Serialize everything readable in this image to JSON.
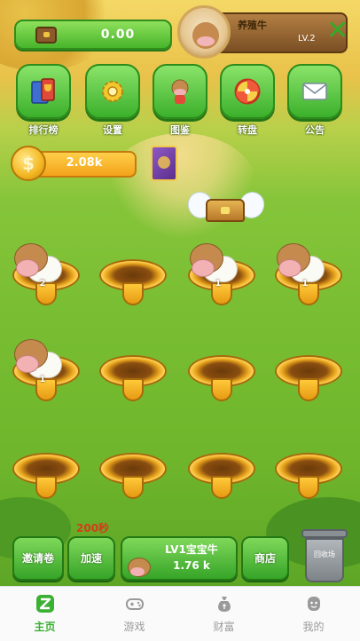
{
  "wallet": {
    "icon": "wallet-icon",
    "value": "0.00"
  },
  "profile": {
    "name": "养殖牛",
    "level": "LV.2",
    "close_icon": "close-x-icon"
  },
  "menu": [
    {
      "id": "ranking",
      "icon": "trophy-book-icon",
      "label": "排行榜"
    },
    {
      "id": "settings",
      "icon": "gear-icon",
      "label": "设置"
    },
    {
      "id": "collection",
      "icon": "cow-character-icon",
      "label": "图鉴"
    },
    {
      "id": "turntable",
      "icon": "lucky-wheel-icon",
      "label": "转盘"
    },
    {
      "id": "notice",
      "icon": "envelope-icon",
      "label": "公告"
    }
  ],
  "gold": {
    "icon": "dollar-coin-icon",
    "coin_symbol": "$",
    "value": "2.08k"
  },
  "holes": [
    {
      "row": 1,
      "col": 1,
      "cow_level": "2"
    },
    {
      "row": 1,
      "col": 2,
      "cow_level": null
    },
    {
      "row": 1,
      "col": 3,
      "cow_level": "1"
    },
    {
      "row": 1,
      "col": 4,
      "cow_level": "1"
    },
    {
      "row": 2,
      "col": 1,
      "cow_level": "1"
    },
    {
      "row": 2,
      "col": 2,
      "cow_level": null
    },
    {
      "row": 2,
      "col": 3,
      "cow_level": null
    },
    {
      "row": 2,
      "col": 4,
      "cow_level": null
    },
    {
      "row": 3,
      "col": 1,
      "cow_level": null
    },
    {
      "row": 3,
      "col": 2,
      "cow_level": null
    },
    {
      "row": 3,
      "col": 3,
      "cow_level": null
    },
    {
      "row": 3,
      "col": 4,
      "cow_level": null
    }
  ],
  "actions": {
    "timer": "200秒",
    "invite_label": "邀请卷",
    "speed_label": "加速",
    "buy_title": "LV1宝宝牛",
    "buy_price": "1.76 k",
    "shop_label": "商店",
    "recycle_label": "回收场"
  },
  "tabs": [
    {
      "label": "主页",
      "icon": "home-z-icon",
      "active": true
    },
    {
      "label": "游戏",
      "icon": "gamepad-icon",
      "active": false
    },
    {
      "label": "财富",
      "icon": "money-bag-icon",
      "active": false
    },
    {
      "label": "我的",
      "icon": "user-icon",
      "active": false
    }
  ],
  "colors": {
    "accent_green": "#3cb034",
    "gold": "#f3a21a",
    "timer_red": "#d83a1a"
  }
}
